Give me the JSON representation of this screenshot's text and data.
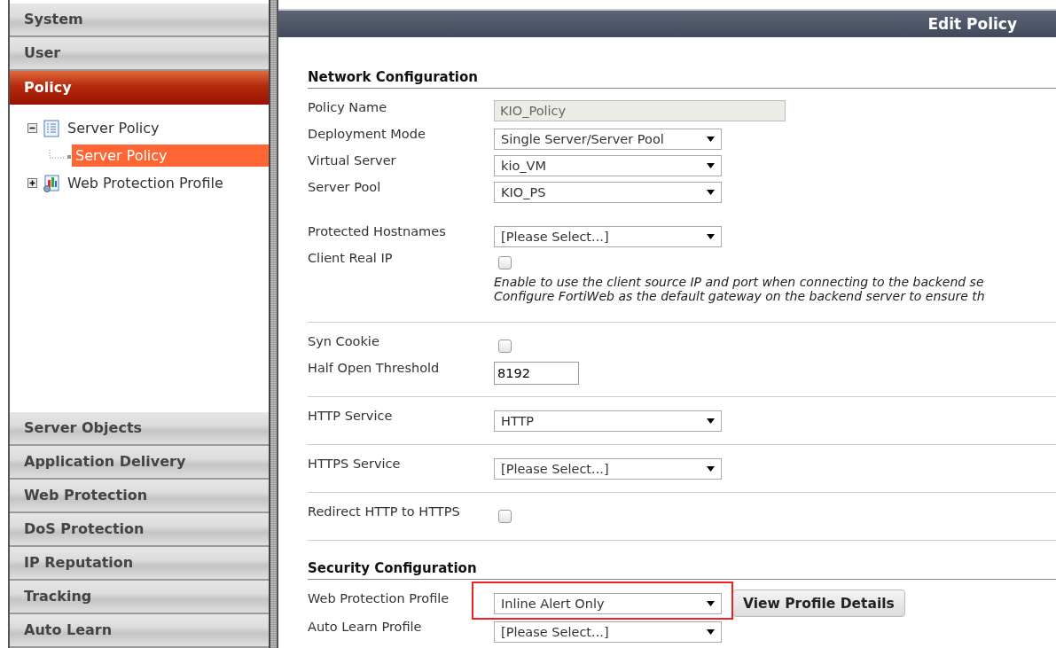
{
  "sidebar": {
    "menu": [
      {
        "label": "System",
        "selected": false
      },
      {
        "label": "User",
        "selected": false
      },
      {
        "label": "Policy",
        "selected": true,
        "tree": [
          {
            "label": "Server Policy",
            "kind": "list",
            "expanded": true,
            "selected": false,
            "children": [
              {
                "label": "Server Policy",
                "selected": true
              }
            ]
          },
          {
            "label": "Web Protection Profile",
            "kind": "chart",
            "expanded": false,
            "selected": false
          }
        ]
      },
      {
        "label": "Server Objects",
        "selected": false
      },
      {
        "label": "Application Delivery",
        "selected": false
      },
      {
        "label": "Web Protection",
        "selected": false
      },
      {
        "label": "DoS Protection",
        "selected": false
      },
      {
        "label": "IP Reputation",
        "selected": false
      },
      {
        "label": "Tracking",
        "selected": false
      },
      {
        "label": "Auto Learn",
        "selected": false
      }
    ]
  },
  "main": {
    "title": "Edit Policy",
    "sections": [
      {
        "title": "Network Configuration",
        "groups": [
          {
            "rows": [
              {
                "kind": "text",
                "label": "Policy Name",
                "value": "KIO_Policy",
                "disabled": true
              },
              {
                "kind": "select",
                "label": "Deployment Mode",
                "value": "Single Server/Server Pool"
              },
              {
                "kind": "select",
                "label": "Virtual Server",
                "value": "kio_VM"
              },
              {
                "kind": "select",
                "label": "Server Pool",
                "value": "KIO_PS"
              }
            ]
          },
          {
            "rows": [
              {
                "kind": "select",
                "label": "Protected Hostnames",
                "value": "[Please Select...]"
              },
              {
                "kind": "checkbox",
                "label": "Client Real IP",
                "checked": false
              },
              {
                "kind": "note",
                "lines": [
                  "Enable to use the client source IP and port when connecting to the backend se",
                  "Configure FortiWeb as the default gateway on the backend server to ensure th"
                ]
              }
            ]
          },
          {
            "rows": [
              {
                "kind": "checkbox",
                "label": "Syn Cookie",
                "checked": false
              },
              {
                "kind": "number",
                "label": "Half Open Threshold",
                "value": "8192"
              }
            ]
          },
          {
            "rows": [
              {
                "kind": "select",
                "label": "HTTP Service",
                "value": "HTTP"
              }
            ]
          },
          {
            "rows": [
              {
                "kind": "select",
                "label": "HTTPS Service",
                "value": "[Please Select...]"
              }
            ]
          },
          {
            "rows": [
              {
                "kind": "checkbox",
                "label": "Redirect HTTP to HTTPS",
                "checked": false
              }
            ]
          }
        ]
      },
      {
        "title": "Security Configuration",
        "groups": [
          {
            "rows": [
              {
                "kind": "select",
                "label": "Web Protection Profile",
                "value": "Inline Alert Only",
                "highlighted": true,
                "button": "View Profile Details"
              },
              {
                "kind": "select",
                "label": "Auto Learn Profile",
                "value": "[Please Select...]"
              }
            ]
          }
        ]
      }
    ]
  }
}
